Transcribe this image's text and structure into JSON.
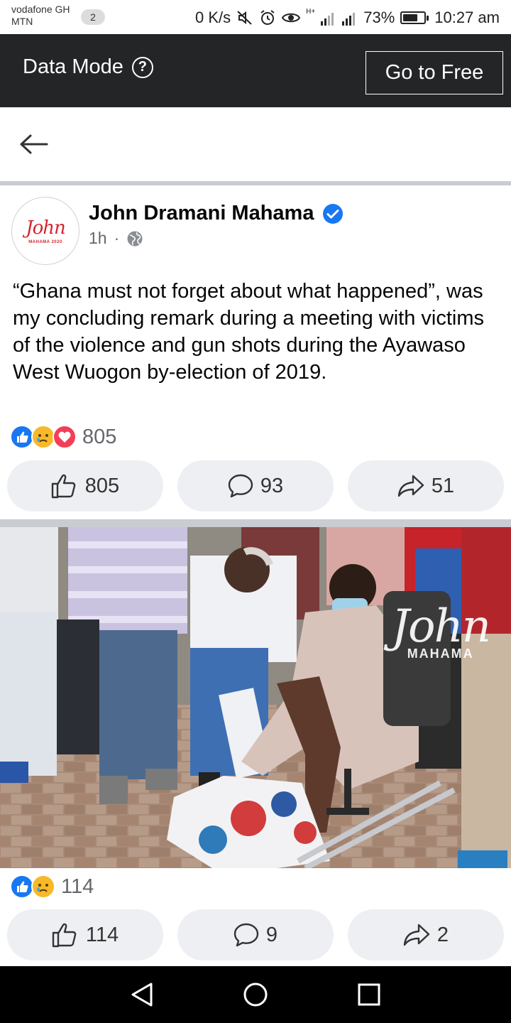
{
  "status_bar": {
    "carrier_line1": "vodafone GH",
    "carrier_line2": "MTN",
    "sim_badge": "2",
    "net_speed": "0 K/s",
    "network_type": "H+",
    "battery_percent": "73%",
    "battery_level": 0.73,
    "time": "10:27 am"
  },
  "data_bar": {
    "title": "Data Mode",
    "help_icon": "?",
    "go_free_label": "Go to Free"
  },
  "post": {
    "author": "John Dramani Mahama",
    "avatar_logo": "John",
    "avatar_sub": "MAHAMA 2020",
    "time": "1h",
    "separator": "·",
    "text": "“Ghana must not forget about what happened”, was my concluding remark during a meeting with victims of the violence and gun shots during the Ayawaso West Wuogon by-election of 2019.",
    "reaction_count": "805",
    "like_count": "805",
    "comment_count": "93",
    "share_count": "51"
  },
  "photo_post": {
    "watermark_word": "John",
    "watermark_sub": "MAHAMA",
    "reaction_count": "114",
    "like_count": "114",
    "comment_count": "9",
    "share_count": "2"
  },
  "colors": {
    "dark_bar": "#242526",
    "like_blue": "#1877f2",
    "verified_blue": "#1877f2",
    "action_bg": "#eeeff2",
    "divider": "#c9ccd1"
  },
  "icons": [
    "back-arrow-icon",
    "verified-icon",
    "globe-icon",
    "thumbs-up-icon",
    "comment-icon",
    "share-icon",
    "help-icon",
    "wifi-icon",
    "signal-icon",
    "alarm-icon",
    "mute-icon",
    "eye-icon",
    "nav-back-icon",
    "nav-home-icon",
    "nav-recents-icon"
  ]
}
